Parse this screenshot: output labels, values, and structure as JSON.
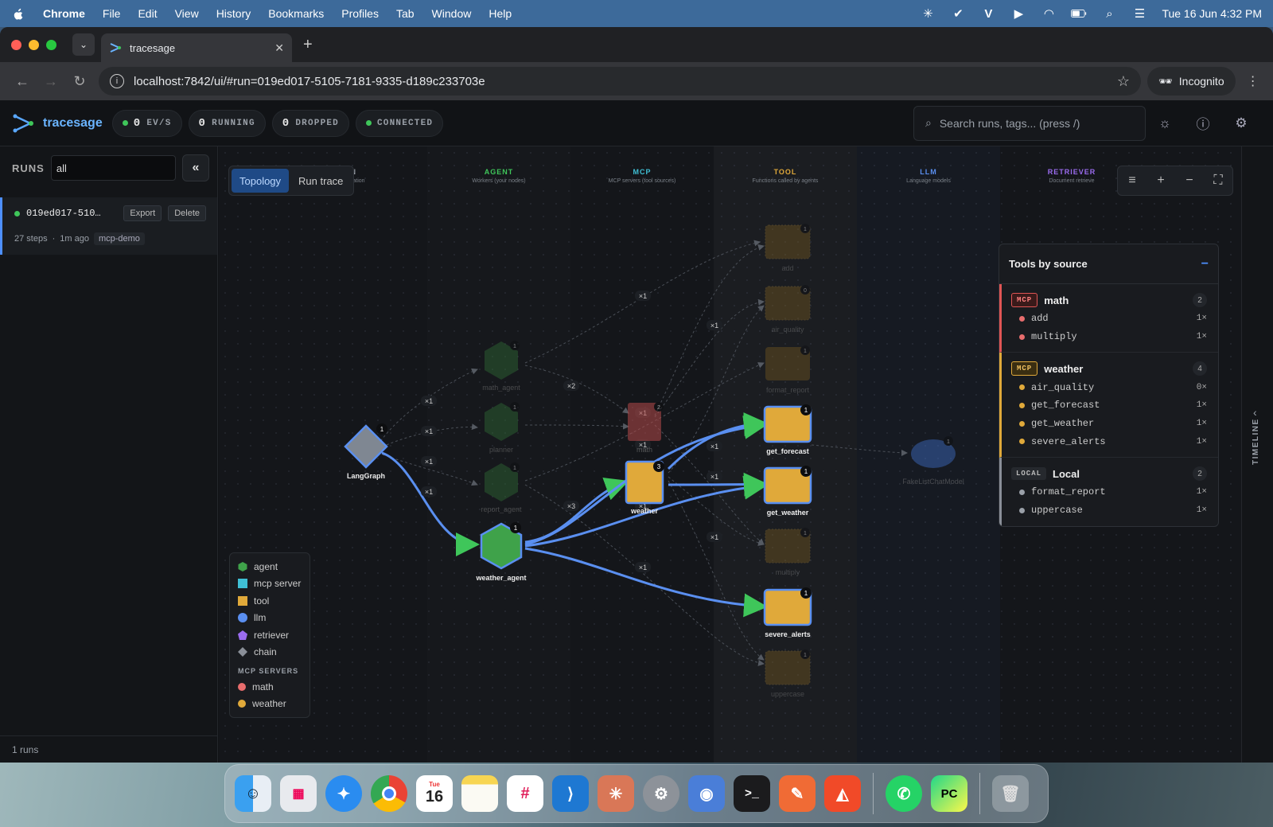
{
  "menubar": {
    "app": "Chrome",
    "items": [
      "File",
      "Edit",
      "View",
      "History",
      "Bookmarks",
      "Profiles",
      "Tab",
      "Window",
      "Help"
    ],
    "clock": "Tue 16 Jun  4:32 PM"
  },
  "browser": {
    "tab_title": "tracesage",
    "url": "localhost:7842/ui/#run=019ed017-5105-7181-9335-d189c233703e",
    "profile": "Incognito"
  },
  "header": {
    "brand": "tracesage",
    "evs_value": "0",
    "evs_label": "EV/S",
    "running_value": "0",
    "running_label": "RUNNING",
    "dropped_value": "0",
    "dropped_label": "DROPPED",
    "connected_label": "CONNECTED",
    "search_placeholder": "Search runs, tags... (press /)"
  },
  "sidebar": {
    "runs_label": "RUNS",
    "filter_value": "all",
    "run": {
      "id": "019ed017-510…",
      "export": "Export",
      "delete": "Delete",
      "steps": "27 steps",
      "sep": "·",
      "age": "1m ago",
      "tag": "mcp-demo"
    },
    "footer": "1 runs"
  },
  "canvas": {
    "tabs": [
      "Topology",
      "Run trace"
    ],
    "columns": [
      {
        "title": "HAIN",
        "sub": "& orchestration",
        "color": "#9aa0a8"
      },
      {
        "title": "AGENT",
        "sub": "Workers (your nodes)",
        "color": "#3fc65a"
      },
      {
        "title": "MCP",
        "sub": "MCP servers (tool sources)",
        "color": "#3fbfd4"
      },
      {
        "title": "TOOL",
        "sub": "Functions called by agents",
        "color": "#e0a93a"
      },
      {
        "title": "LLM",
        "sub": "Language models",
        "color": "#5a8ff0"
      },
      {
        "title": "RETRIEVER",
        "sub": "Document retrieve",
        "color": "#9b6cf0"
      }
    ],
    "nodes": {
      "langgraph": "LangGraph",
      "math_agent": "math_agent",
      "planner": "planner",
      "report_agent": "report_agent",
      "weather_agent": "weather_agent",
      "math": "math",
      "weather": "weather",
      "add": "add",
      "air_quality": "air_quality",
      "format_report": "format_report",
      "get_forecast": "get_forecast",
      "get_weather": "get_weather",
      "multiply": "multiply",
      "severe_alerts": "severe_alerts",
      "uppercase": "uppercase",
      "llm": "FakeListChatModel"
    },
    "node_counts": {
      "langgraph": "1",
      "math_agent": "1",
      "planner": "1",
      "report_agent": "1",
      "weather_agent": "1",
      "math": "2",
      "weather": "3",
      "add": "1",
      "air_quality": "0",
      "format_report": "1",
      "get_forecast": "1",
      "get_weather": "1",
      "multiply": "1",
      "severe_alerts": "1",
      "uppercase": "1",
      "llm": "1"
    },
    "edge_labels": [
      "×1",
      "×1",
      "×1",
      "×1",
      "×1",
      "×2",
      "×1",
      "×1",
      "×3",
      "×1",
      "×1",
      "×1",
      "×1",
      "×1",
      "×1",
      "×1"
    ],
    "legend": {
      "items": [
        {
          "label": "agent",
          "color": "#3fa24a",
          "shape": "hex"
        },
        {
          "label": "mcp server",
          "color": "#3fbfd4",
          "shape": "square"
        },
        {
          "label": "tool",
          "color": "#e0a93a",
          "shape": "square"
        },
        {
          "label": "llm",
          "color": "#5a8ff0",
          "shape": "circle"
        },
        {
          "label": "retriever",
          "color": "#9b6cf0",
          "shape": "pent"
        },
        {
          "label": "chain",
          "color": "#8a8f98",
          "shape": "diamond"
        }
      ],
      "section": "MCP SERVERS",
      "servers": [
        {
          "label": "math",
          "color": "#e86d6d"
        },
        {
          "label": "weather",
          "color": "#e0a93a"
        }
      ]
    }
  },
  "tools_panel": {
    "title": "Tools by source",
    "groups": [
      {
        "badge": "MCP",
        "name": "math",
        "count": "2",
        "accent": "#e05555",
        "tools": [
          {
            "name": "add",
            "count": "1×"
          },
          {
            "name": "multiply",
            "count": "1×"
          }
        ]
      },
      {
        "badge": "MCP",
        "name": "weather",
        "count": "4",
        "accent": "#e0a93a",
        "tools": [
          {
            "name": "air_quality",
            "count": "0×"
          },
          {
            "name": "get_forecast",
            "count": "1×"
          },
          {
            "name": "get_weather",
            "count": "1×"
          },
          {
            "name": "severe_alerts",
            "count": "1×"
          }
        ]
      },
      {
        "badge": "LOCAL",
        "name": "Local",
        "count": "2",
        "accent": "#8a8f98",
        "tools": [
          {
            "name": "format_report",
            "count": "1×"
          },
          {
            "name": "uppercase",
            "count": "1×"
          }
        ]
      }
    ]
  },
  "timeline_label": "TIMELINE",
  "dock": {
    "calendar_day": "16",
    "calendar_month": "Tue"
  }
}
